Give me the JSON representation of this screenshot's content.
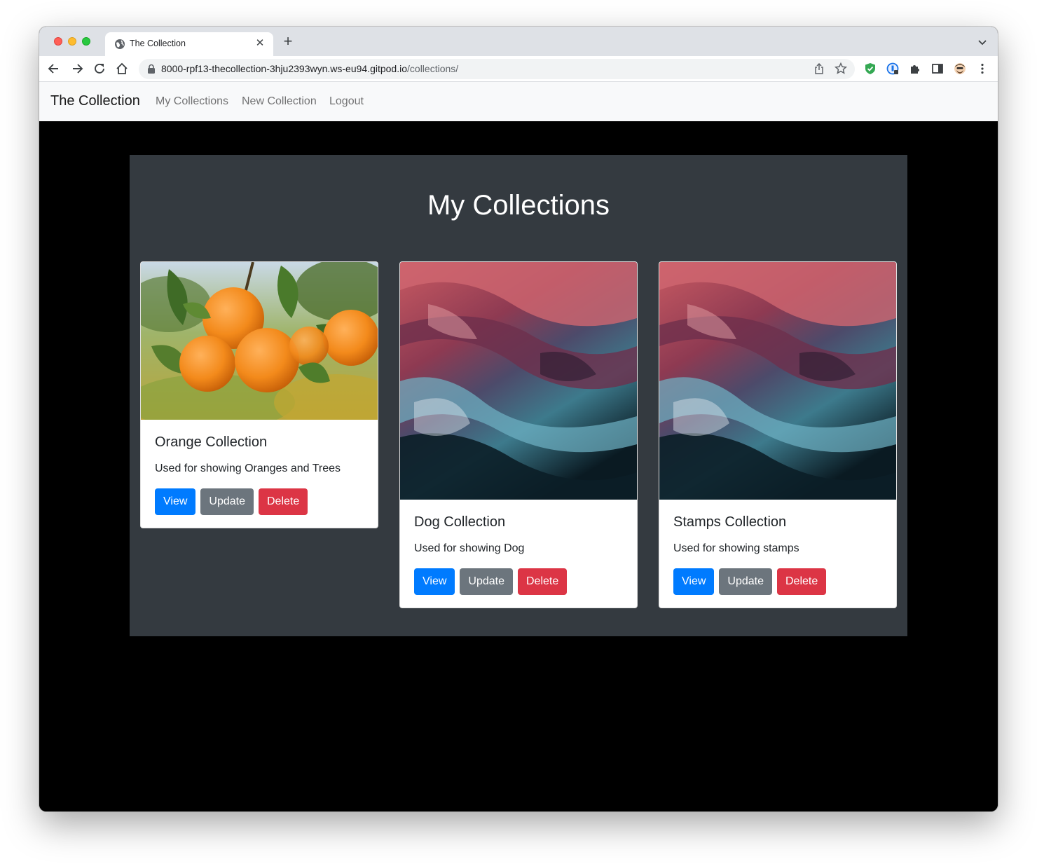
{
  "browser": {
    "tab_title": "The Collection",
    "new_tab_symbol": "+",
    "close_tab_symbol": "✕",
    "url_host": "8000-rpf13-thecollection-3hju2393wyn.ws-eu94.gitpod.io",
    "url_path": "/collections/"
  },
  "navbar": {
    "brand": "The Collection",
    "links": [
      "My Collections",
      "New Collection",
      "Logout"
    ],
    "background": "#f8f9fa"
  },
  "main": {
    "heading": "My Collections",
    "panel_color": "#343a40",
    "cards": [
      {
        "title": "Orange Collection",
        "description": "Used for showing Oranges and Trees",
        "image": "orange-tree-photo",
        "buttons": [
          "View",
          "Update",
          "Delete"
        ]
      },
      {
        "title": "Dog Collection",
        "description": "Used for showing Dog",
        "image": "abstract-red-blue-fluid-image",
        "buttons": [
          "View",
          "Update",
          "Delete"
        ]
      },
      {
        "title": "Stamps Collection",
        "description": "Used for showing stamps",
        "image": "abstract-red-blue-fluid-image",
        "buttons": [
          "View",
          "Update",
          "Delete"
        ]
      }
    ]
  },
  "colors": {
    "primary": "#007bff",
    "secondary": "#6c757d",
    "danger": "#dc3545"
  }
}
